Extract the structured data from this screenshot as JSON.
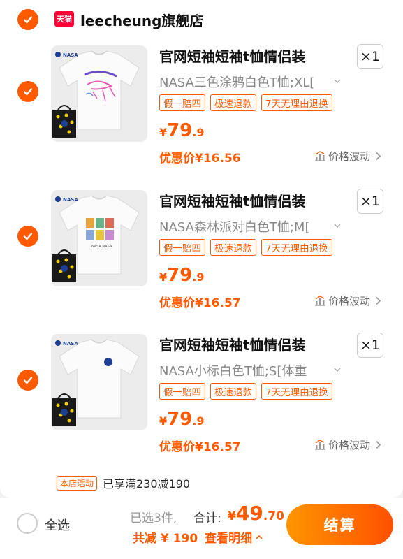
{
  "colors": {
    "accent": "#ff5a00",
    "tmall": "#ff0036"
  },
  "shop": {
    "badge": "天猫",
    "name": "leecheung旗舰店"
  },
  "items": [
    {
      "title": "官网短袖短袖t恤情侣装",
      "quantity": "×1",
      "sku": "NASA三色涂鸦白色T恤;XL[",
      "tags": [
        "假一赔四",
        "极速退款",
        "7天无理由退换"
      ],
      "price_currency": "¥",
      "price_int": "79",
      "price_dec": ".9",
      "promo": "优惠价¥16.56",
      "trend": "价格波动",
      "print": "graffiti"
    },
    {
      "title": "官网短袖短袖t恤情侣装",
      "quantity": "×1",
      "sku": "NASA森林派对白色T恤;M[",
      "tags": [
        "假一赔四",
        "极速退款",
        "7天无理由退换"
      ],
      "price_currency": "¥",
      "price_int": "79",
      "price_dec": ".9",
      "promo": "优惠价¥16.57",
      "trend": "价格波动",
      "print": "grid"
    },
    {
      "title": "官网短袖短袖t恤情侣装",
      "quantity": "×1",
      "sku": "NASA小标白色T恤;S[体重",
      "tags": [
        "假一赔四",
        "极速退款",
        "7天无理由退换"
      ],
      "price_currency": "¥",
      "price_int": "79",
      "price_dec": ".9",
      "promo": "优惠价¥16.57",
      "trend": "价格波动",
      "print": "logo"
    }
  ],
  "activity": {
    "badge": "本店活动",
    "text": "已享满230减190"
  },
  "footer": {
    "select_all": "全选",
    "selected_count": "已选3件,",
    "total_label": "合计:",
    "total_currency": "¥",
    "total_int": "49",
    "total_dec": ".70",
    "discount": "共减 ¥ 190",
    "details": "查看明细",
    "checkout": "结算"
  }
}
